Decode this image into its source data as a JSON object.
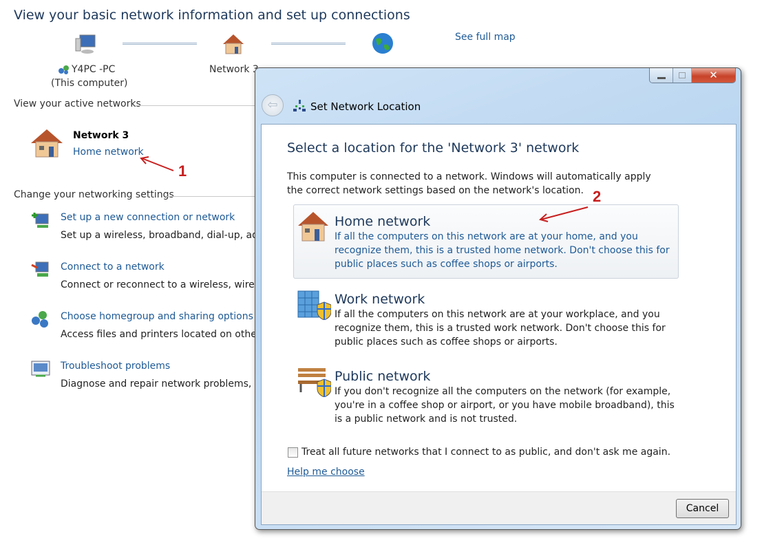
{
  "page": {
    "title": "View your basic network information and set up connections",
    "see_full_map": "See full map"
  },
  "map": {
    "computer_name": "Y4PC -PC",
    "computer_sub": "(This computer)",
    "network": "Network  3"
  },
  "active": {
    "header": "View your active networks",
    "network_name": "Network  3",
    "network_type": "Home network"
  },
  "settings": {
    "header": "Change your networking settings",
    "items": [
      {
        "icon": "new-connection-icon",
        "title": "Set up a new connection or network",
        "desc": "Set up a wireless, broadband, dial-up, ad h"
      },
      {
        "icon": "connect-network-icon",
        "title": "Connect to a network",
        "desc": "Connect or reconnect to a wireless, wired, d"
      },
      {
        "icon": "homegroup-icon",
        "title": "Choose homegroup and sharing options",
        "desc": "Access files and printers located on other n"
      },
      {
        "icon": "troubleshoot-icon",
        "title": "Troubleshoot problems",
        "desc": "Diagnose and repair network problems, or"
      }
    ]
  },
  "annotations": [
    "1",
    "2"
  ],
  "dialog": {
    "title": "Set Network Location",
    "heading": "Select a location for the 'Network  3' network",
    "intro": "This computer is connected to a network. Windows will automatically apply the correct network settings based on the network's location.",
    "options": [
      {
        "icon": "home-icon",
        "title": "Home network",
        "desc": "If all the computers on this network are at your home, and you recognize them, this is a trusted home network.  Don't choose this for public places such as coffee shops or airports."
      },
      {
        "icon": "work-building-icon",
        "title": "Work network",
        "desc": "If all the computers on this network are at your workplace, and you recognize them, this is a trusted work network.  Don't choose this for public places such as coffee shops or airports."
      },
      {
        "icon": "park-bench-icon",
        "title": "Public network",
        "desc": "If you don't recognize all the computers on the network (for example, you're in a coffee shop or airport, or you have mobile broadband), this is a public network and is not trusted."
      }
    ],
    "checkbox": {
      "label": "Treat all future networks that I connect to as public, and don't ask me again.",
      "checked": false
    },
    "help": "Help me choose",
    "cancel": "Cancel"
  },
  "colors": {
    "link": "#1e5a96",
    "heading": "#1e395b",
    "annotation": "#c81e1e"
  }
}
